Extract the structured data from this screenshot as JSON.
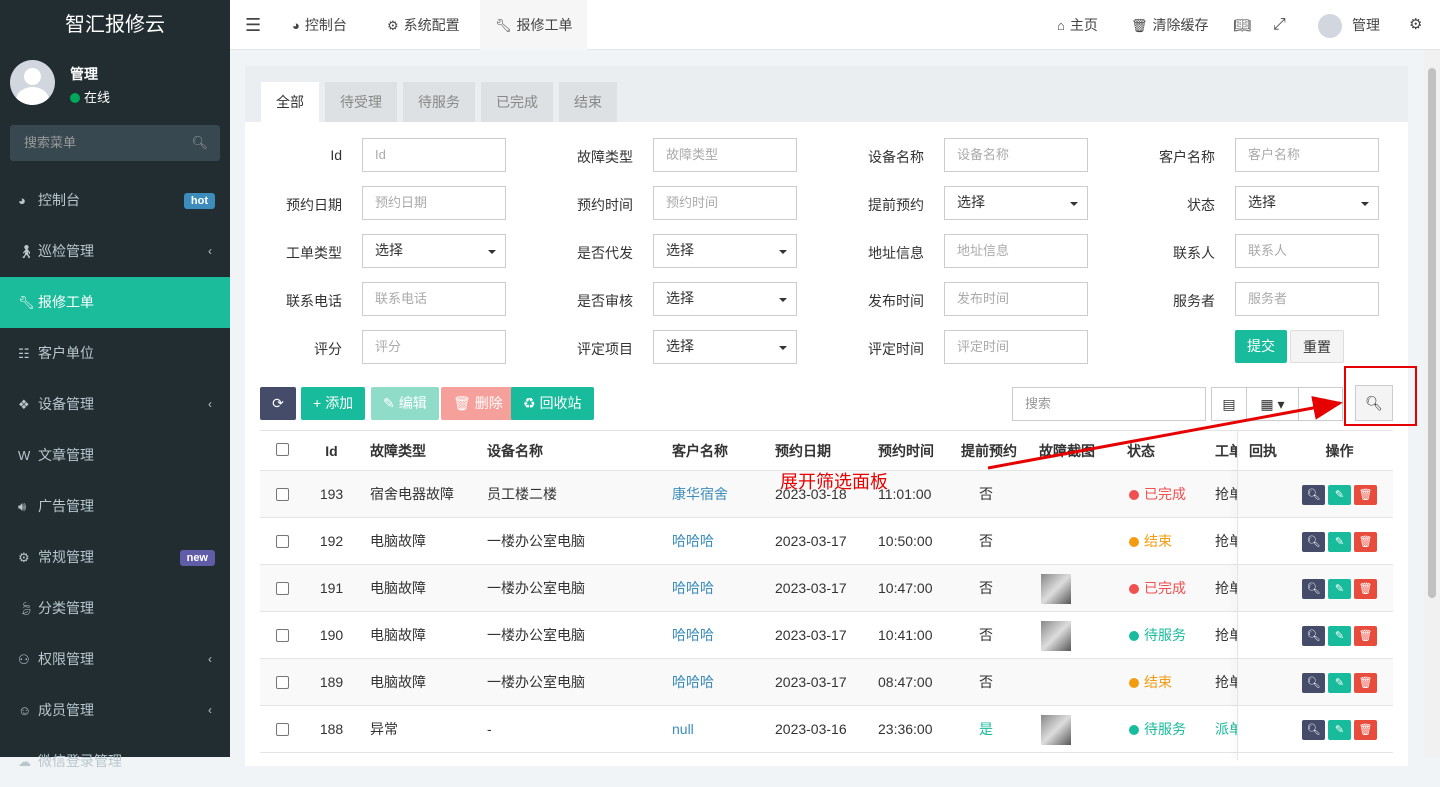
{
  "sidebar": {
    "brand": "智汇报修云",
    "user": {
      "name": "管理",
      "status": "在线"
    },
    "search_placeholder": "搜索菜单",
    "items": [
      {
        "label": "控制台",
        "icon": "dashboard-icon",
        "badge": "hot",
        "badge_color": "#3c8dbc"
      },
      {
        "label": "巡检管理",
        "icon": "walk-icon",
        "has_children": true
      },
      {
        "label": "报修工单",
        "icon": "wrench-icon",
        "active": true
      },
      {
        "label": "客户单位",
        "icon": "address-book-icon"
      },
      {
        "label": "设备管理",
        "icon": "cubes-icon",
        "has_children": true
      },
      {
        "label": "文章管理",
        "icon": "wordpress-icon"
      },
      {
        "label": "广告管理",
        "icon": "volume-icon"
      },
      {
        "label": "常规管理",
        "icon": "cogs-icon",
        "badge": "new",
        "badge_color": "#605ca8"
      },
      {
        "label": "分类管理",
        "icon": "leaf-icon"
      },
      {
        "label": "权限管理",
        "icon": "group-icon",
        "has_children": true
      },
      {
        "label": "成员管理",
        "icon": "user-circle-icon",
        "has_children": true
      },
      {
        "label": "微信登录管理",
        "icon": "wechat-icon"
      }
    ]
  },
  "header": {
    "menu_icon": "bars-icon",
    "tabs": [
      {
        "label": "控制台",
        "icon": "dashboard-icon"
      },
      {
        "label": "系统配置",
        "icon": "gear-icon"
      },
      {
        "label": "报修工单",
        "icon": "wrench-icon",
        "active": true
      }
    ],
    "right": {
      "home": "主页",
      "clear_cache": "清除缓存",
      "user": "管理"
    }
  },
  "filter_tabs": [
    "全部",
    "待受理",
    "待服务",
    "已完成",
    "结束"
  ],
  "filter": {
    "fields": [
      {
        "label": "Id",
        "placeholder": "Id",
        "type": "input"
      },
      {
        "label": "故障类型",
        "placeholder": "故障类型",
        "type": "input"
      },
      {
        "label": "设备名称",
        "placeholder": "设备名称",
        "type": "input"
      },
      {
        "label": "客户名称",
        "placeholder": "客户名称",
        "type": "input"
      },
      {
        "label": "预约日期",
        "placeholder": "预约日期",
        "type": "input"
      },
      {
        "label": "预约时间",
        "placeholder": "预约时间",
        "type": "input"
      },
      {
        "label": "提前预约",
        "value": "选择",
        "type": "select"
      },
      {
        "label": "状态",
        "value": "选择",
        "type": "select"
      },
      {
        "label": "工单类型",
        "value": "选择",
        "type": "select"
      },
      {
        "label": "是否代发",
        "value": "选择",
        "type": "select"
      },
      {
        "label": "地址信息",
        "placeholder": "地址信息",
        "type": "input"
      },
      {
        "label": "联系人",
        "placeholder": "联系人",
        "type": "input"
      },
      {
        "label": "联系电话",
        "placeholder": "联系电话",
        "type": "input"
      },
      {
        "label": "是否审核",
        "value": "选择",
        "type": "select"
      },
      {
        "label": "发布时间",
        "placeholder": "发布时间",
        "type": "input"
      },
      {
        "label": "服务者",
        "placeholder": "服务者",
        "type": "input"
      },
      {
        "label": "评分",
        "placeholder": "评分",
        "type": "input"
      },
      {
        "label": "评定项目",
        "value": "选择",
        "type": "select"
      },
      {
        "label": "评定时间",
        "placeholder": "评定时间",
        "type": "input"
      }
    ],
    "submit": "提交",
    "reset": "重置"
  },
  "toolbar": {
    "add": "添加",
    "edit": "编辑",
    "delete": "删除",
    "recycle": "回收站",
    "search_placeholder": "搜索"
  },
  "table": {
    "headers": [
      "Id",
      "故障类型",
      "设备名称",
      "客户名称",
      "预约日期",
      "预约时间",
      "提前预约",
      "故障截图",
      "状态",
      "工单类",
      "回执",
      "操作"
    ],
    "rows": [
      {
        "id": "193",
        "type": "宿舍电器故障",
        "device": "员工楼二楼",
        "customer": "康华宿舍",
        "date": "2023-03-18",
        "time": "11:01:00",
        "early": "否",
        "shot": false,
        "status": "已完成",
        "status_color": "#f05050",
        "order_type": "抢单"
      },
      {
        "id": "192",
        "type": "电脑故障",
        "device": "一楼办公室电脑",
        "customer": "哈哈哈",
        "date": "2023-03-17",
        "time": "10:50:00",
        "early": "否",
        "shot": false,
        "status": "结束",
        "status_color": "#f39c12",
        "order_type": "抢单"
      },
      {
        "id": "191",
        "type": "电脑故障",
        "device": "一楼办公室电脑",
        "customer": "哈哈哈",
        "date": "2023-03-17",
        "time": "10:47:00",
        "early": "否",
        "shot": true,
        "status": "已完成",
        "status_color": "#f05050",
        "order_type": "抢单"
      },
      {
        "id": "190",
        "type": "电脑故障",
        "device": "一楼办公室电脑",
        "customer": "哈哈哈",
        "date": "2023-03-17",
        "time": "10:41:00",
        "early": "否",
        "shot": true,
        "status": "待服务",
        "status_color": "#18bc9c",
        "order_type": "抢单"
      },
      {
        "id": "189",
        "type": "电脑故障",
        "device": "一楼办公室电脑",
        "customer": "哈哈哈",
        "date": "2023-03-17",
        "time": "08:47:00",
        "early": "否",
        "shot": false,
        "status": "结束",
        "status_color": "#f39c12",
        "order_type": "抢单"
      },
      {
        "id": "188",
        "type": "异常",
        "device": "-",
        "customer": "null",
        "date": "2023-03-16",
        "time": "23:36:00",
        "early": "是",
        "shot": true,
        "status": "待服务",
        "status_color": "#18bc9c",
        "order_type": "派单"
      }
    ]
  },
  "annotation": "展开筛选面板",
  "colors": {
    "sidebar_bg": "#222d32",
    "accent": "#1abc9c",
    "dark_button": "#444c69",
    "danger": "#e74c3c",
    "link": "#3c8dbc",
    "annotation_red": "#e60000"
  }
}
